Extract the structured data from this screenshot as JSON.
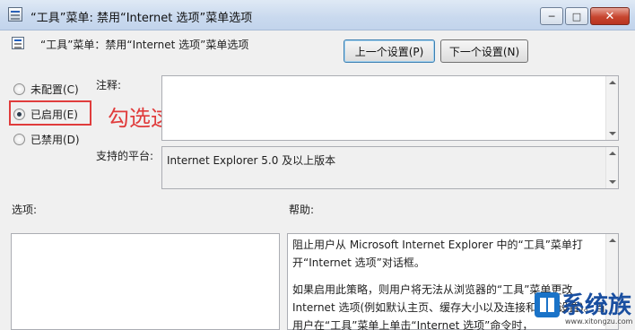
{
  "window": {
    "title": "“工具”菜单: 禁用“Internet 选项”菜单选项",
    "minimize": "─",
    "maximize": "□",
    "close": "✕"
  },
  "policy": {
    "name": "“工具”菜单：禁用“Internet 选项”菜单选项",
    "prev_button": "上一个设置(P)",
    "next_button": "下一个设置(N)"
  },
  "state": {
    "options": [
      {
        "label": "未配置(C)",
        "selected": false
      },
      {
        "label": "已启用(E)",
        "selected": true
      },
      {
        "label": "已禁用(D)",
        "selected": false
      }
    ],
    "annotation": "勾选这里"
  },
  "comment": {
    "label": "注释:",
    "value": ""
  },
  "platform": {
    "label": "支持的平台:",
    "value": "Internet Explorer 5.0 及以上版本"
  },
  "options_section": {
    "label": "选项:"
  },
  "help_section": {
    "label": "帮助:",
    "paragraphs": [
      "阻止用户从 Microsoft Internet Explorer 中的“工具”菜单打开“Internet 选项”对话框。",
      "如果启用此策略，则用户将无法从浏览器的“工具”菜单更改 Internet 选项(例如默认主页、缓存大小以及连接和代理设置)。当用户在“工具”菜单上单击“Internet 选项”命令时，"
    ]
  },
  "watermark": {
    "brand": "系统族",
    "url": "www.xitongzu.com"
  },
  "icons": {
    "app": "policy-editor-icon",
    "setting": "policy-setting-icon"
  }
}
